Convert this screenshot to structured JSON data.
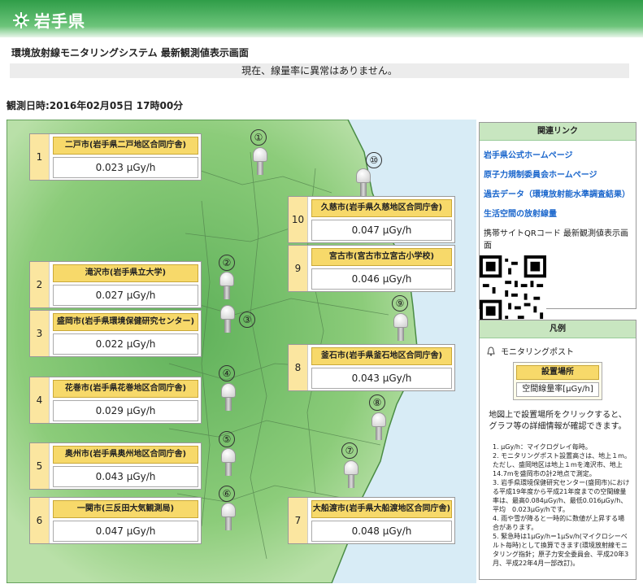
{
  "header": {
    "logo_icon": "prefecture-emblem-icon",
    "logo_text": "岩手県"
  },
  "system_title": "環境放射線モニタリングシステム 最新観測値表示画面",
  "status_message": "現在、線量率に異常はありません。",
  "observation_datetime": "観測日時:2016年02月05日 17時00分",
  "sites": [
    {
      "num": "1",
      "name": "二戸市(岩手県二戸地区合同庁舎)",
      "value": "0.023 μGy/h",
      "marker": "①"
    },
    {
      "num": "2",
      "name": "滝沢市(岩手県立大学)",
      "value": "0.027 μGy/h",
      "marker": "②"
    },
    {
      "num": "3",
      "name": "盛岡市(岩手県環境保健研究センター)",
      "value": "0.022 μGy/h",
      "marker": "③"
    },
    {
      "num": "4",
      "name": "花巻市(岩手県花巻地区合同庁舎)",
      "value": "0.029 μGy/h",
      "marker": "④"
    },
    {
      "num": "5",
      "name": "奥州市(岩手県奥州地区合同庁舎)",
      "value": "0.043 μGy/h",
      "marker": "⑤"
    },
    {
      "num": "6",
      "name": "一関市(三反田大気観測局)",
      "value": "0.047 μGy/h",
      "marker": "⑥"
    },
    {
      "num": "7",
      "name": "大船渡市(岩手県大船渡地区合同庁舎)",
      "value": "0.048 μGy/h",
      "marker": "⑦"
    },
    {
      "num": "8",
      "name": "釜石市(岩手県釜石地区合同庁舎)",
      "value": "0.043 μGy/h",
      "marker": "⑧"
    },
    {
      "num": "9",
      "name": "宮古市(宮古市立宮古小学校)",
      "value": "0.046 μGy/h",
      "marker": "⑨"
    },
    {
      "num": "10",
      "name": "久慈市(岩手県久慈地区合同庁舎)",
      "value": "0.047 μGy/h",
      "marker": "⑩"
    }
  ],
  "related_links": {
    "title": "関連リンク",
    "items": [
      "岩手県公式ホームページ",
      "原子力規制委員会ホームページ",
      "過去データ（環境放射能水準調査結果）",
      "生活空間の放射線量"
    ],
    "qr_label": "携帯サイトQRコード 最新観測値表示画面"
  },
  "legend": {
    "title": "凡例",
    "post_icon": "bell-icon",
    "post_label": "モニタリングポスト",
    "box_name": "設置場所",
    "box_value": "空間線量率[μGy/h]",
    "info": "地図上で設置場所をクリックすると、グラフ等の詳細情報が確認できます。",
    "notes": [
      "1. μGy/h：マイクログレイ毎時。",
      "2. モニタリングポスト設置高さは、地上１m。ただし、盛岡地区は地上１mを滝沢市、地上14.7mを盛岡市の計2地点で測定。",
      "3. 岩手県環境保健研究センター(盛岡市)における平成19年度から平成21年度までの空間線量率は、最高0.084μGy/h、最低0.016μGy/h、平均　0.023μGy/hです。",
      "4. 雨や雪が降ると一時的に数値が上昇する場合があります。",
      "5. 緊急時は1μGy/h＝1μSv/h(マイクロシーベルト毎時)として換算できます(環境放射線モニタリング指針；原子力安全委員会、平成20年3月、平成22年4月一部改訂)。"
    ]
  },
  "colors": {
    "header_green": "#2f9d48",
    "site_name_yellow": "#f7d96a",
    "site_num_bg": "#fbe6a0",
    "link_blue": "#1a66cc",
    "map_land": "#7cc36d",
    "sea": "#d8ecf6"
  }
}
